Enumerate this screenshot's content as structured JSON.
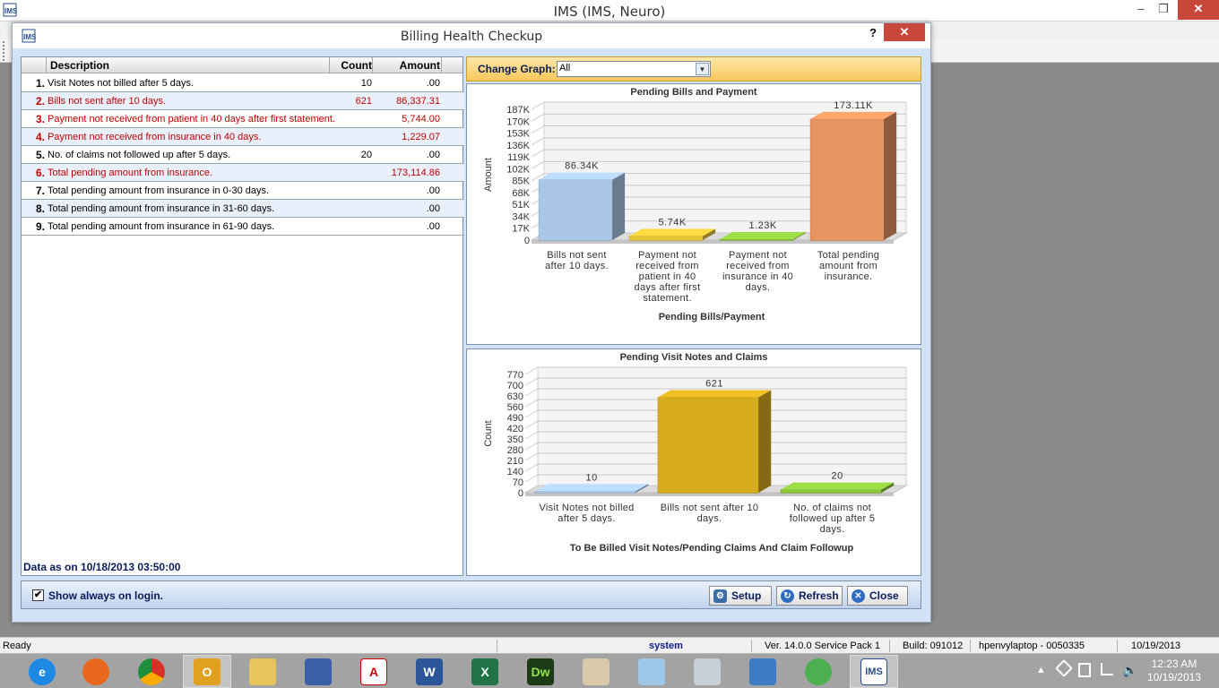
{
  "app": {
    "title": "IMS (IMS, Neuro)"
  },
  "dialog": {
    "title": "Billing Health Checkup",
    "help_label": "?",
    "close_label": "✕"
  },
  "table": {
    "columns": [
      "Description",
      "Count",
      "Amount"
    ],
    "rows": [
      {
        "num": "1.",
        "desc": "Visit Notes not billed after 5 days.",
        "count": "10",
        "amount": ".00",
        "highlight": false
      },
      {
        "num": "2.",
        "desc": "Bills not sent after 10 days.",
        "count": "621",
        "amount": "86,337.31",
        "highlight": true
      },
      {
        "num": "3.",
        "desc": "Payment not received from patient in 40 days after first statement.",
        "count": "",
        "amount": "5,744.00",
        "highlight": true
      },
      {
        "num": "4.",
        "desc": "Payment not received from insurance in 40 days.",
        "count": "",
        "amount": "1,229.07",
        "highlight": true
      },
      {
        "num": "5.",
        "desc": "No. of claims not followed up after 5 days.",
        "count": "20",
        "amount": ".00",
        "highlight": false
      },
      {
        "num": "6.",
        "desc": "Total pending amount from insurance.",
        "count": "",
        "amount": "173,114.86",
        "highlight": true
      },
      {
        "num": "7.",
        "desc": "Total pending amount from insurance in 0-30 days.",
        "count": "",
        "amount": ".00",
        "highlight": false
      },
      {
        "num": "8.",
        "desc": "Total pending amount from insurance in 31-60 days.",
        "count": "",
        "amount": ".00",
        "highlight": false
      },
      {
        "num": "9.",
        "desc": "Total pending amount from insurance in 61-90 days.",
        "count": "",
        "amount": ".00",
        "highlight": false
      }
    ],
    "data_as_on": "Data as on 10/18/2013 03:50:00"
  },
  "change_graph": {
    "label": "Change Graph:",
    "selected": "All"
  },
  "chart_data": [
    {
      "type": "bar",
      "title": "Pending Bills and Payment",
      "xlabel": "Pending Bills/Payment",
      "ylabel": "Amount",
      "ylim": [
        0,
        187000
      ],
      "yticks": [
        "0",
        "17K",
        "34K",
        "51K",
        "68K",
        "85K",
        "102K",
        "119K",
        "136K",
        "153K",
        "170K",
        "187K"
      ],
      "categories": [
        [
          "Bills not sent",
          "after 10 days."
        ],
        [
          "Payment not",
          "received from",
          "patient in 40",
          "days after first",
          "statement."
        ],
        [
          "Payment not",
          "received from",
          "insurance in 40",
          "days."
        ],
        [
          "Total pending",
          "amount from",
          "insurance."
        ]
      ],
      "values": [
        86337.31,
        5744.0,
        1229.07,
        173114.86
      ],
      "labels": [
        "86.34K",
        "5.74K",
        "1.23K",
        "173.11K"
      ],
      "colors": [
        "#a9c6e6",
        "#e8c43a",
        "#8cc63f",
        "#e59560"
      ],
      "grid": true
    },
    {
      "type": "bar",
      "title": "Pending Visit Notes and Claims",
      "xlabel": "To Be Billed Visit Notes/Pending Claims And Claim Followup",
      "ylabel": "Count",
      "ylim": [
        0,
        770
      ],
      "yticks": [
        "0",
        "70",
        "140",
        "210",
        "280",
        "350",
        "420",
        "490",
        "560",
        "630",
        "700",
        "770"
      ],
      "categories": [
        [
          "Visit Notes not billed",
          "after 5 days."
        ],
        [
          "Bills not sent after 10",
          "days."
        ],
        [
          "No. of claims not",
          "followed up after 5",
          "days."
        ]
      ],
      "values": [
        10,
        621,
        20
      ],
      "labels": [
        "10",
        "621",
        "20"
      ],
      "colors": [
        "#a9c6e6",
        "#d7ab1e",
        "#8cc63f"
      ],
      "grid": true
    }
  ],
  "bottom": {
    "show_always_label": "Show always on login.",
    "show_always_checked": true,
    "setup_label": "Setup",
    "refresh_label": "Refresh",
    "close_label": "Close"
  },
  "status": {
    "ready": "Ready",
    "user": "system",
    "version": "Ver. 14.0.0 Service Pack 1",
    "build": "Build: 091012",
    "machine": "hpenvylaptop - 0050335",
    "date": "10/19/2013"
  },
  "taskbar": {
    "time": "12:23 AM",
    "date": "10/19/2013",
    "apps": [
      "ie-icon",
      "firefox-icon",
      "chrome-icon",
      "outlook-icon",
      "file-explorer-icon",
      "remote-desktop-icon",
      "acrobat-icon",
      "word-icon",
      "excel-icon",
      "dreamweaver-icon",
      "paint-icon",
      "notepad-icon",
      "calculator-icon",
      "control-panel-icon",
      "dragon-icon",
      "ims-icon"
    ]
  }
}
